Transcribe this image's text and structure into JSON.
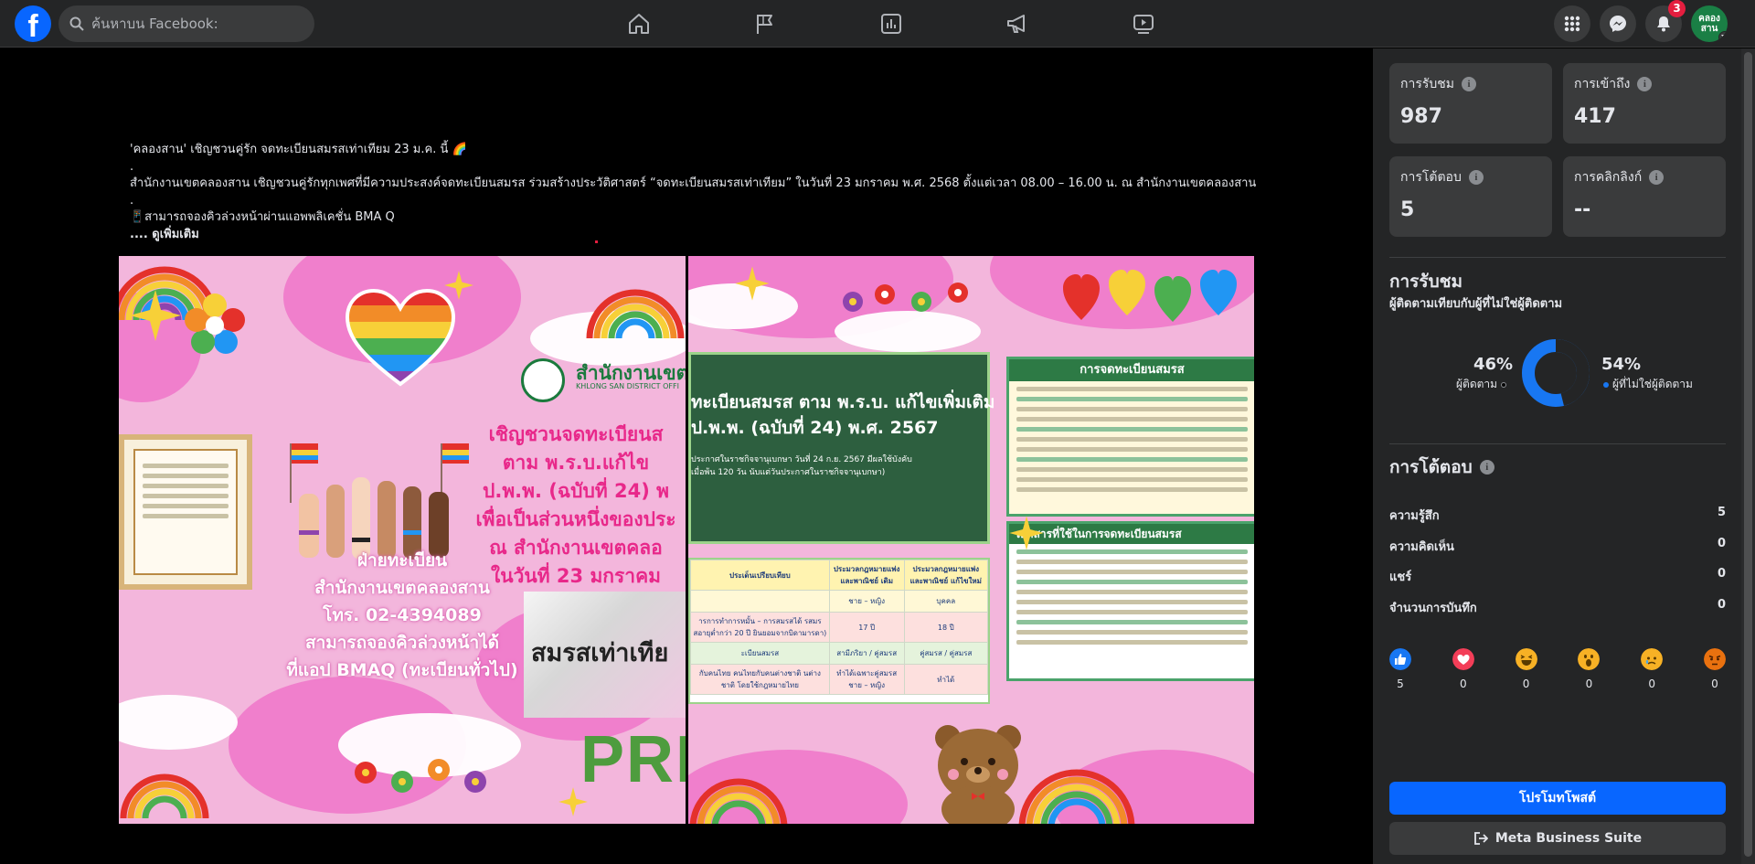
{
  "topbar": {
    "logo": "f",
    "search_placeholder": "ค้นหาบน Facebook:",
    "nav_icons": [
      "home-icon",
      "flag-icon",
      "bar-chart-icon",
      "megaphone-icon",
      "video-icon"
    ],
    "notification_count": "3",
    "avatar_line1": "คลอง",
    "avatar_line2": "สาน"
  },
  "post": {
    "line1": "'คลองสาน' เชิญชวนคู่รัก จดทะเบียนสมรสเท่าเทียม 23 ม.ค. นี้ 🌈",
    "dot1": ".",
    "line2": "สำนักงานเขตคลองสาน เชิญชวนคู่รักทุกเพศที่มีความประสงค์จดทะเบียนสมรส ร่วมสร้างประวัติศาสตร์ “จดทะเบียนสมรสเท่าเทียม” ในวันที่ 23 มกราคม พ.ศ. 2568 ตั้งแต่เวลา 08.00 – 16.00 น. ณ สำนักงานเขตคลองสาน",
    "dot2": ".",
    "line3": "📱สามารถจองคิวล่วงหน้าผ่านแอพพลิเคชั่น BMA Q",
    "see_more": ".... ดูเพิ่มเติม"
  },
  "image_left": {
    "org_title": "สำนักงานเขตค",
    "org_sub": "KHLONG SAN DISTRICT OFFI",
    "invite_lines": [
      "เชิญชวนจดทะเบียนส",
      "ตาม พ.ร.บ.แก้ไข",
      "ป.พ.พ. (ฉบับที่ 24) พ",
      "เพื่อเป็นส่วนหนึ่งของประ",
      "ณ สำนักงานเขตคลอ",
      "ในวันที่ 23 มกราคม"
    ],
    "dept_lines": [
      "ฝ่ายทะเบียน",
      "สำนักงานเขตคลองสาน",
      "โทร. 02-4394089",
      "สามารถจองคิวล่วงหน้าได้",
      "ที่แอป BMAQ (ทะเบียนทั่วไป)"
    ],
    "marriage_label": "สมรสเท่าเทีย",
    "pride": "PRID"
  },
  "image_right": {
    "board_title_1": "ทะเบียนสมรส ตาม พ.ร.บ. แก้ไขเพิ่มเติม",
    "board_title_2": "ป.พ.พ. (ฉบับที่ 24) พ.ศ. 2567",
    "board_note_1": "ประกาศในราชกิจจานุเบกษา วันที่ 24 ก.ย. 2567 มีผลใช้บังคับ",
    "board_note_2": "เมื่อพ้น 120 วัน นับแต่วันประกาศในราชกิจจานุเบกษา)",
    "info_head": "การจดทะเบียนสมรส",
    "doc_head": "เอกสารที่ใช้ในการจดทะเบียนสมรส",
    "compare_headers": [
      "ประเด็นเปรียบเทียบ",
      "ประมวลกฎหมายแพ่งและพาณิชย์ เดิม",
      "ประมวลกฎหมายแพ่งและพาณิชย์ แก้ไขใหม่"
    ],
    "compare_rows": [
      [
        "",
        "ชาย – หญิง",
        "บุคคล"
      ],
      [
        "ารการทำการหมั้น – การสมรสได้ รสมรสอายุต่ำกว่า 20 ปี ยินยอมจากบิดามารดา)",
        "17 ปี",
        "18 ปี"
      ],
      [
        "ะเบียนสมรส",
        "สามีภริยา / คู่สมรส",
        "คู่สมรส / คู่สมรส"
      ],
      [
        "กับคนไทย คนไทยกับคนต่างชาติ นต่างชาติ โดยใช้กฎหมายไทย",
        "ทำได้เฉพาะคู่สมรส ชาย – หญิง",
        "ทำได้"
      ]
    ]
  },
  "sidebar": {
    "stats": [
      {
        "label": "การรับชม",
        "value": "987"
      },
      {
        "label": "การเข้าถึง",
        "value": "417"
      },
      {
        "label": "การโต้ตอบ",
        "value": "5"
      },
      {
        "label": "การคลิกลิงก์",
        "value": "--"
      }
    ],
    "views_title": "การรับชม",
    "views_sub": "ผู้ติดตามเทียบกับผู้ที่ไม่ใช่ผู้ติดตาม",
    "followers_pct": "46%",
    "followers_label": "ผู้ติดตาม",
    "non_followers_pct": "54%",
    "non_followers_label": "ผู้ที่ไม่ใช่ผู้ติดตาม",
    "followers_fraction": 0.46,
    "followers_color": "#242526",
    "non_followers_color": "#1877f2",
    "engagement_title": "การโต้ตอบ",
    "engagement_rows": [
      {
        "label": "ความรู้สึก",
        "value": "5"
      },
      {
        "label": "ความคิดเห็น",
        "value": "0"
      },
      {
        "label": "แชร์",
        "value": "0"
      },
      {
        "label": "จำนวนการบันทึก",
        "value": "0"
      }
    ],
    "reactions": [
      {
        "icon": "like-icon",
        "count": "5"
      },
      {
        "icon": "love-icon",
        "count": "0"
      },
      {
        "icon": "haha-icon",
        "count": "0"
      },
      {
        "icon": "wow-icon",
        "count": "0"
      },
      {
        "icon": "sad-icon",
        "count": "0"
      },
      {
        "icon": "angry-icon",
        "count": "0"
      }
    ],
    "promote_label": "โปรโมทโพสต์",
    "business_suite_label": "Meta Business Suite"
  }
}
